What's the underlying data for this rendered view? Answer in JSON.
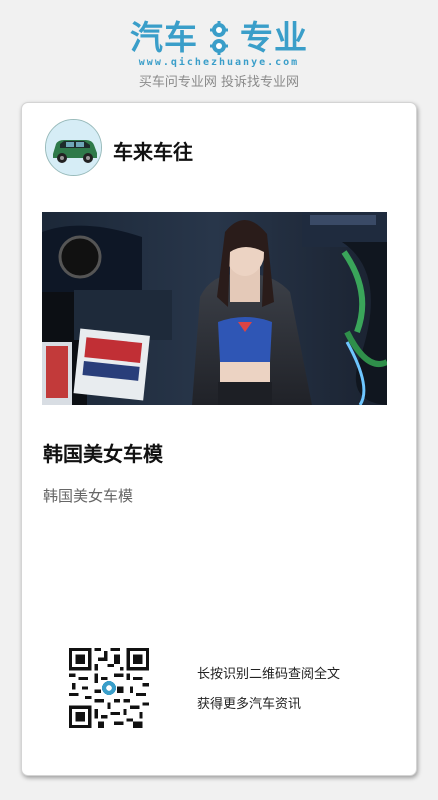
{
  "brand": {
    "logo_left": "汽车",
    "logo_right": "专业",
    "url": "www.qichezhuanye.com",
    "slogan": "买车问专业网 投诉找专业网",
    "accent_color": "#3a9ec9"
  },
  "card": {
    "author_name": "车来车往",
    "avatar_icon": "green-car-icon",
    "photo_icon": "car-show-model-photo",
    "title": "韩国美女车模",
    "summary": "韩国美女车模",
    "qr_icon": "qr-code-icon",
    "cta_line1": "长按识别二维码查阅全文",
    "cta_line2": "获得更多汽车资讯"
  }
}
